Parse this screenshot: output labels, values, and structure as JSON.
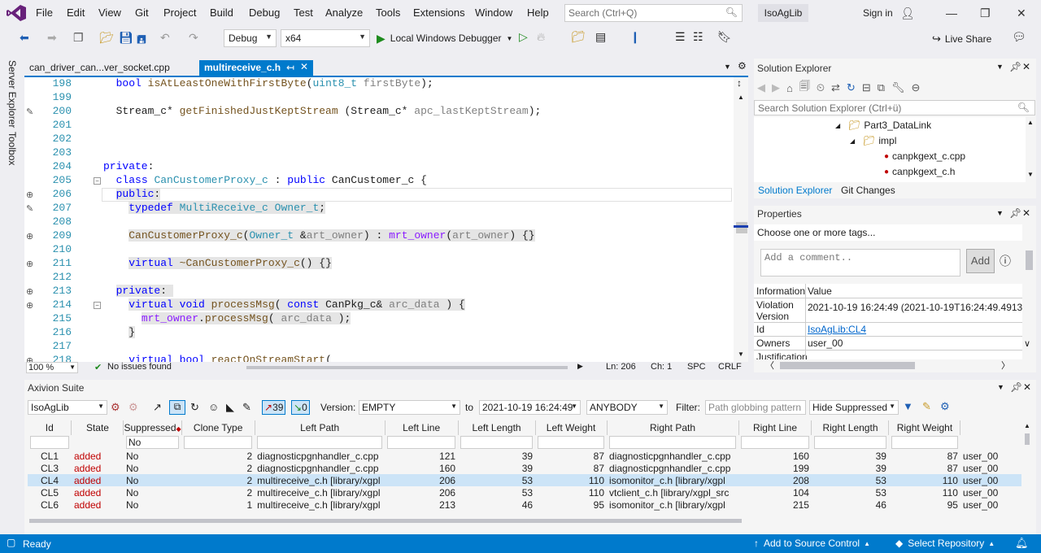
{
  "menu": [
    "File",
    "Edit",
    "View",
    "Git",
    "Project",
    "Build",
    "Debug",
    "Test",
    "Analyze",
    "Tools",
    "Extensions",
    "Window",
    "Help"
  ],
  "search": {
    "placeholder": "Search (Ctrl+Q)"
  },
  "solution_name": "IsoAgLib",
  "signin": "Sign in",
  "toolbar": {
    "config": "Debug",
    "platform": "x64",
    "debugger": "Local Windows Debugger",
    "live_share": "Live Share"
  },
  "tabs": [
    {
      "label": "can_driver_can...ver_socket.cpp"
    },
    {
      "label": "multireceive_c.h"
    }
  ],
  "side_tools": [
    "Server Explorer",
    "Toolbox"
  ],
  "code_lines": [
    {
      "n": "198",
      "html": "  <span class='kw'>bool</span> <span class='fn'>isAtLeastOneWithFirstByte</span>(<span class='ty'>uint8_t</span> <span class='pr'>firstByte</span>);"
    },
    {
      "n": "199",
      "html": ""
    },
    {
      "n": "200",
      "html": "  Stream_c* <span class='fn'>getFinishedJustKeptStream</span> (Stream_c* <span class='pr'>apc_lastKeptStream</span>);"
    },
    {
      "n": "201",
      "html": ""
    },
    {
      "n": "202",
      "html": ""
    },
    {
      "n": "203",
      "html": ""
    },
    {
      "n": "204",
      "html": "<span class='kw'>private</span>:"
    },
    {
      "n": "205",
      "html": "  <span class='kw'>class</span> <span class='ty'>CanCustomerProxy_c</span> : <span class='kw'>public</span> CanCustomer_c {"
    },
    {
      "n": "206",
      "html": "  <span class='kw hl'>public</span><span class='hl'>:</span>"
    },
    {
      "n": "207",
      "html": "    <span class='hl'><span class='kw'>typedef</span> <span class='ty'>MultiReceive_c</span> <span class='ty'>Owner_t</span>;</span>"
    },
    {
      "n": "208",
      "html": ""
    },
    {
      "n": "209",
      "html": "    <span class='hl'><span class='fn'>CanCustomerProxy_c</span>(<span class='ty'>Owner_t</span> &amp;<span class='pr'>art_owner</span>) : <span class='mb'>mrt_owner</span>(<span class='pr'>art_owner</span>) {}</span>"
    },
    {
      "n": "210",
      "html": ""
    },
    {
      "n": "211",
      "html": "    <span class='hl'><span class='kw'>virtual</span> <span class='fn'>~CanCustomerProxy_c</span>() {}</span>"
    },
    {
      "n": "212",
      "html": ""
    },
    {
      "n": "213",
      "html": "  <span class='hl'><span class='kw'>private</span>: </span>"
    },
    {
      "n": "214",
      "html": "    <span class='hl'><span class='kw'>virtual</span> <span class='kw'>void</span> <span class='fn'>processMsg</span>( <span class='kw'>const</span> CanPkg_c&amp; <span class='pr'>arc_data</span> ) {</span>"
    },
    {
      "n": "215",
      "html": "      <span class='hl'><span class='mb'>mrt_owner</span>.<span class='fn'>processMsg</span>( <span class='pr'>arc_data</span> );</span>"
    },
    {
      "n": "216",
      "html": "    <span class='hl'>}</span>"
    },
    {
      "n": "217",
      "html": ""
    },
    {
      "n": "218",
      "html": "    <span class='kw'>virtual</span> <span class='kw'>bool</span> <span class='fn'>reactOnStreamStart</span>("
    }
  ],
  "editor_status": {
    "zoom": "100 %",
    "issues": "No issues found",
    "ln": "Ln: 206",
    "ch": "Ch: 1",
    "spc": "SPC",
    "crlf": "CRLF"
  },
  "solution_explorer": {
    "title": "Solution Explorer",
    "search_placeholder": "Search Solution Explorer (Ctrl+ü)",
    "items": [
      "Part3_DataLink",
      "impl",
      "canpkgext_c.cpp",
      "canpkgext_c.h"
    ],
    "tabs": [
      "Solution Explorer",
      "Git Changes"
    ]
  },
  "properties": {
    "title": "Properties",
    "tags_placeholder": "Choose one or more tags...",
    "comment_placeholder": "Add a comment..",
    "add_label": "Add",
    "header": [
      "Information",
      "Value"
    ],
    "rows": [
      {
        "k": "Violation Version",
        "v": "2021-10-19 16:24:49 (2021-10-19T16:24:49.49139"
      },
      {
        "k": "Id",
        "v": "IsoAgLib:CL4"
      },
      {
        "k": "Owners",
        "v": "user_00"
      },
      {
        "k": "Justification",
        "v": ""
      }
    ]
  },
  "axivion": {
    "title": "Axivion Suite",
    "project": "IsoAgLib",
    "count_up": "39",
    "count_down": "0",
    "version_label": "Version:",
    "version_value": "EMPTY",
    "to_label": "to",
    "to_value": "2021-10-19 16:24:49",
    "anybody": "ANYBODY",
    "filter_label": "Filter:",
    "filter_placeholder": "Path globbing pattern",
    "hide": "Hide Suppressed",
    "columns": [
      "Id",
      "State",
      "Suppressed",
      "Clone Type",
      "Left Path",
      "Left Line",
      "Left Length",
      "Left Weight",
      "Right Path",
      "Right Line",
      "Right Length",
      "Right Weight",
      ""
    ],
    "suppressed_filter": "No",
    "rows": [
      [
        "CL1",
        "added",
        "No",
        "2",
        "diagnosticpgnhandler_c.cpp",
        "121",
        "39",
        "87",
        "diagnosticpgnhandler_c.cpp",
        "160",
        "39",
        "87",
        "user_00"
      ],
      [
        "CL3",
        "added",
        "No",
        "2",
        "diagnosticpgnhandler_c.cpp",
        "160",
        "39",
        "87",
        "diagnosticpgnhandler_c.cpp",
        "199",
        "39",
        "87",
        "user_00"
      ],
      [
        "CL4",
        "added",
        "No",
        "2",
        "multireceive_c.h [library/xgpl",
        "206",
        "53",
        "110",
        "isomonitor_c.h [library/xgpl",
        "208",
        "53",
        "110",
        "user_00"
      ],
      [
        "CL5",
        "added",
        "No",
        "2",
        "multireceive_c.h [library/xgpl",
        "206",
        "53",
        "110",
        "vtclient_c.h [library/xgpl_src",
        "104",
        "53",
        "110",
        "user_00"
      ],
      [
        "CL6",
        "added",
        "No",
        "1",
        "multireceive_c.h [library/xgpl",
        "213",
        "46",
        "95",
        "isomonitor_c.h [library/xgpl",
        "215",
        "46",
        "95",
        "user_00"
      ]
    ]
  },
  "statusbar": {
    "ready": "Ready",
    "source": "Add to Source Control",
    "repo": "Select Repository"
  },
  "colors": {
    "accent": "#007acc",
    "added": "#c00000",
    "selected_row": "#cce4f7"
  }
}
